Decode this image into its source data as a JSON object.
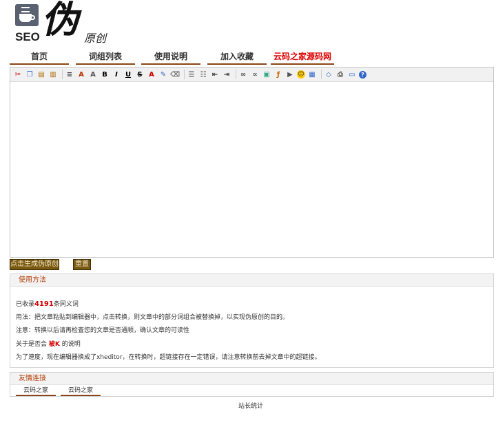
{
  "logo": {
    "seo": "SEO",
    "big_char": "伪",
    "small_chars": "原创"
  },
  "nav": [
    {
      "label": "首页"
    },
    {
      "label": "词组列表"
    },
    {
      "label": "使用说明"
    },
    {
      "label": "加入收藏"
    },
    {
      "label": "云码之家源码网"
    }
  ],
  "toolbar": {
    "icons": [
      "cut-icon",
      "copy-icon",
      "paste-icon",
      "paste-text-icon",
      "separator",
      "format-icon",
      "font-icon",
      "font-size-icon",
      "bold-icon",
      "italic-icon",
      "underline-icon",
      "strikethrough-icon",
      "font-color-icon",
      "highlight-icon",
      "remove-format-icon",
      "separator",
      "align-icon",
      "list-icon",
      "outdent-icon",
      "indent-icon",
      "separator",
      "link-icon",
      "unlink-icon",
      "image-icon",
      "flash-icon",
      "media-icon",
      "emoticon-icon",
      "table-icon",
      "separator",
      "source-icon",
      "preview-icon",
      "fullscreen-icon",
      "help-icon"
    ]
  },
  "buttons": {
    "generate": "点击生成伪原创",
    "reset": "重置"
  },
  "usage": {
    "title": "使用方法",
    "count_prefix": "已收录",
    "count": "4191",
    "count_suffix": "条同义词",
    "usage_line": "用法：把文章粘贴到编辑器中，点击转换，则文章中的部分词组合被替换掉，以实现伪原创的目的。",
    "note_line": "注意：转换以后请再检查您的文章是否通顺，确认文章的可读性",
    "about_prefix": "关于是否会",
    "about_keyword": "被K",
    "about_suffix": "的说明",
    "speed_line": "为了速度，现在编辑器换成了xheditor，在转换时，超链接存在一定错误，请注意转换前去掉文章中的超链接。"
  },
  "friends": {
    "title": "友情连接",
    "links": [
      "云码之家",
      "云码之家"
    ]
  },
  "footer": "站长统计"
}
